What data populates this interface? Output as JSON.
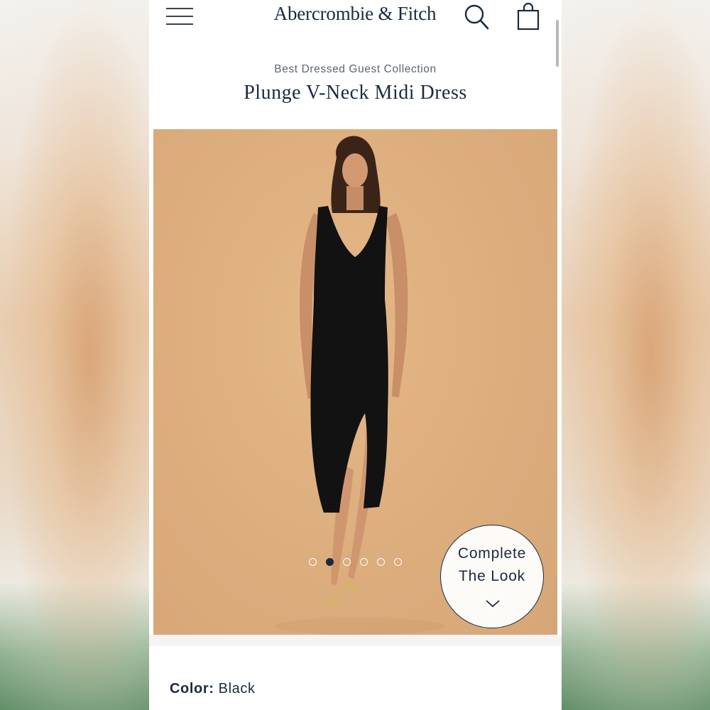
{
  "header": {
    "brand": "Abercrombie & Fitch",
    "menu_icon": "hamburger-menu-icon",
    "search_icon": "search-icon",
    "bag_icon": "shopping-bag-icon"
  },
  "product": {
    "collection": "Best Dressed Guest Collection",
    "name": "Plunge V-Neck Midi Dress",
    "image_alt": "model wearing black plunge v-neck midi dress",
    "gallery": {
      "count": 6,
      "active_index": 1
    },
    "complete_look": {
      "line1": "Complete",
      "line2": "The Look",
      "icon": "chevron-down-icon"
    },
    "color_label": "Color:",
    "color_value": "Black"
  },
  "colors": {
    "brand_navy": "#1b2a3f",
    "hero_bg": "#dcad7d",
    "dress": "#111111"
  }
}
